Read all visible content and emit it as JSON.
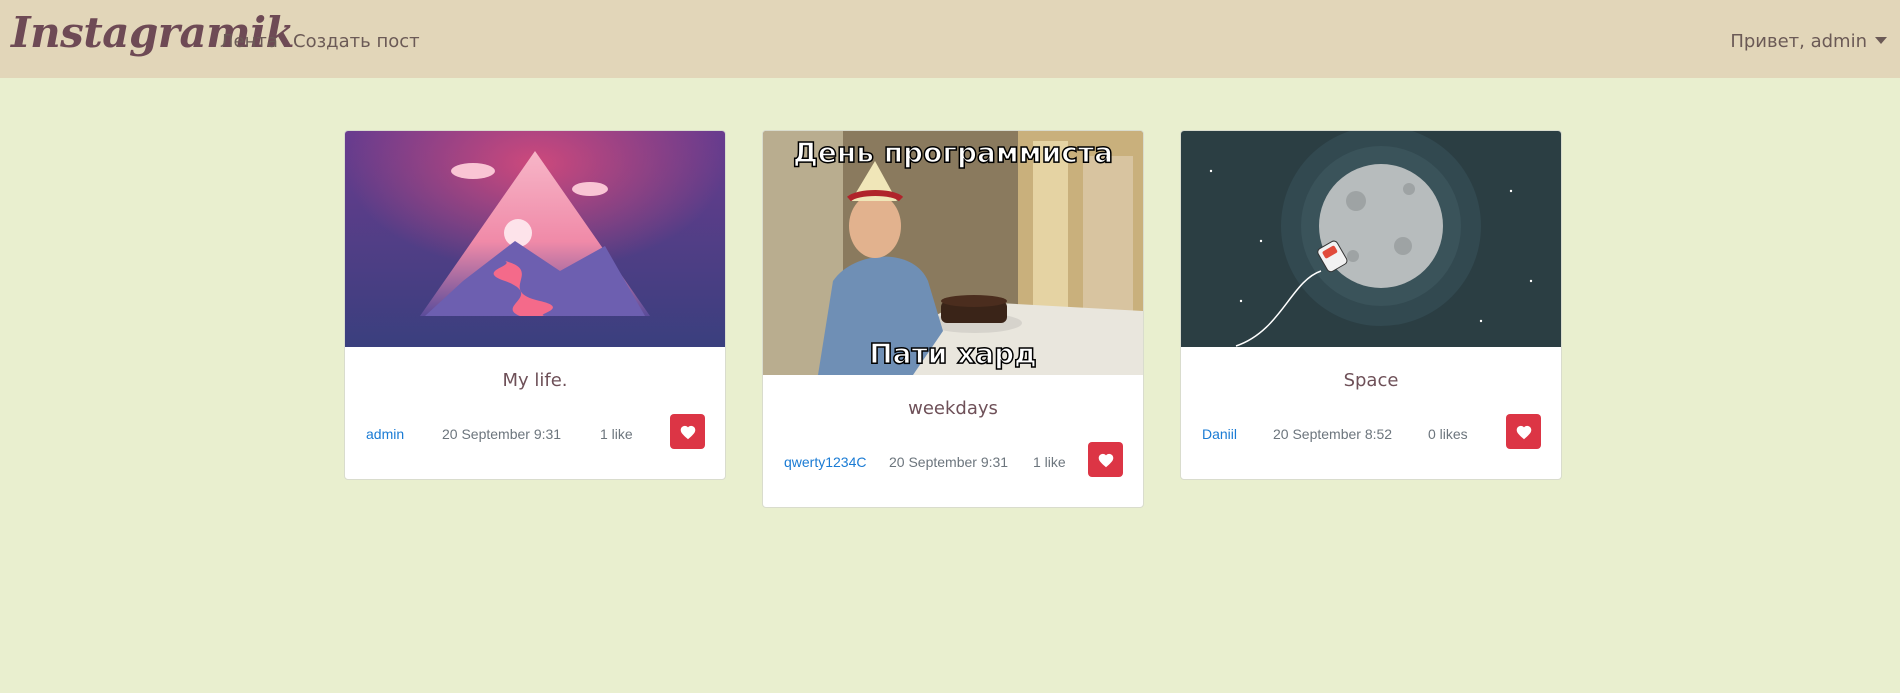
{
  "navbar": {
    "brand": "Instagramik",
    "links": [
      {
        "label": "Лента"
      },
      {
        "label": "Создать пост"
      }
    ],
    "user_greeting": "Привет, admin"
  },
  "posts": [
    {
      "title": "My life.",
      "author": "admin",
      "date": "20 September 9:31",
      "likes": "1 like",
      "image": "mountain-sunset-illustration"
    },
    {
      "title": "weekdays",
      "author": "qwerty1234C",
      "date": "20 September 9:31",
      "likes": "1 like",
      "image": "programmer-day-meme",
      "meme_top": "День программиста",
      "meme_bottom": "Пати хард"
    },
    {
      "title": "Space",
      "author": "Daniil",
      "date": "20 September 8:52",
      "likes": "0 likes",
      "image": "astronaut-moon-illustration"
    }
  ],
  "colors": {
    "navbar": "#e2d6b9",
    "page": "#e9efcf",
    "like": "#dc3545",
    "link": "#1a7bd4"
  }
}
